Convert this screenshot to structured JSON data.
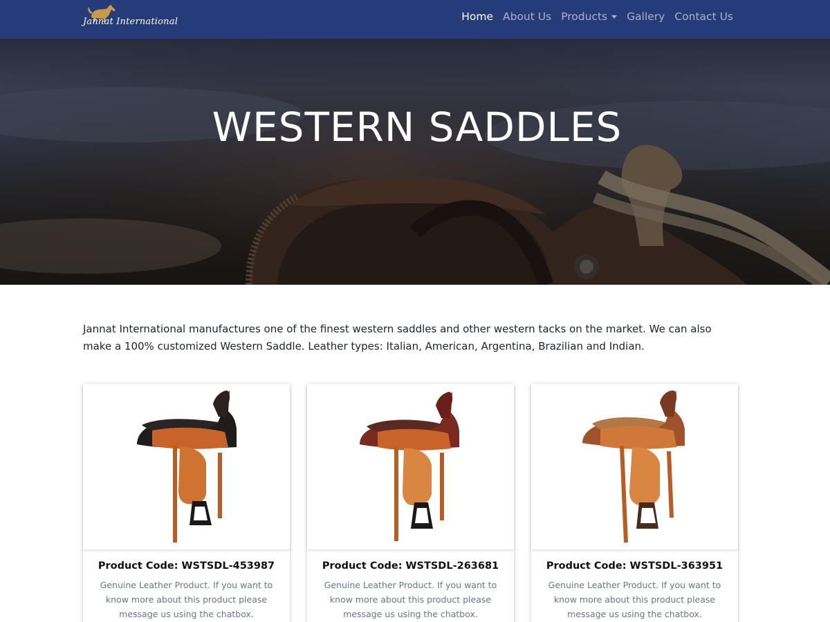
{
  "navbar": {
    "brand_text": "Jannat International",
    "links": [
      {
        "label": "Home",
        "active": true
      },
      {
        "label": "About Us",
        "active": false
      },
      {
        "label": "Products",
        "active": false,
        "dropdown": true
      },
      {
        "label": "Gallery",
        "active": false
      },
      {
        "label": "Contact Us",
        "active": false
      }
    ]
  },
  "hero": {
    "title": "WESTERN SADDLES"
  },
  "intro": {
    "text": "Jannat International manufactures one of the finest western saddles and other western tacks on the market. We can also make a 100% customized Western Saddle. Leather types: Italian, American, Argentina, Brazilian and Indian."
  },
  "products": [
    {
      "code": "Product Code: WSTSDL-453987",
      "description": "Genuine Leather Product. If you want to know more about this product please message us using the chatbox."
    },
    {
      "code": "Product Code: WSTSDL-263681",
      "description": "Genuine Leather Product. If you want to know more about this product please message us using the chatbox."
    },
    {
      "code": "Product Code: WSTSDL-363951",
      "description": "Genuine Leather Product. If you want to know more about this product please message us using the chatbox."
    }
  ],
  "colors": {
    "navbar_bg": "#263c7a",
    "nav_text_active": "#ffffff",
    "leather_tan": "#c8642a",
    "leather_black": "#1e1c1c",
    "leather_burgundy": "#7a2a1e",
    "muted_text": "#6c757d"
  },
  "icons": {
    "brand_logo": "horse-logo-icon",
    "dropdown": "caret-down-icon"
  }
}
